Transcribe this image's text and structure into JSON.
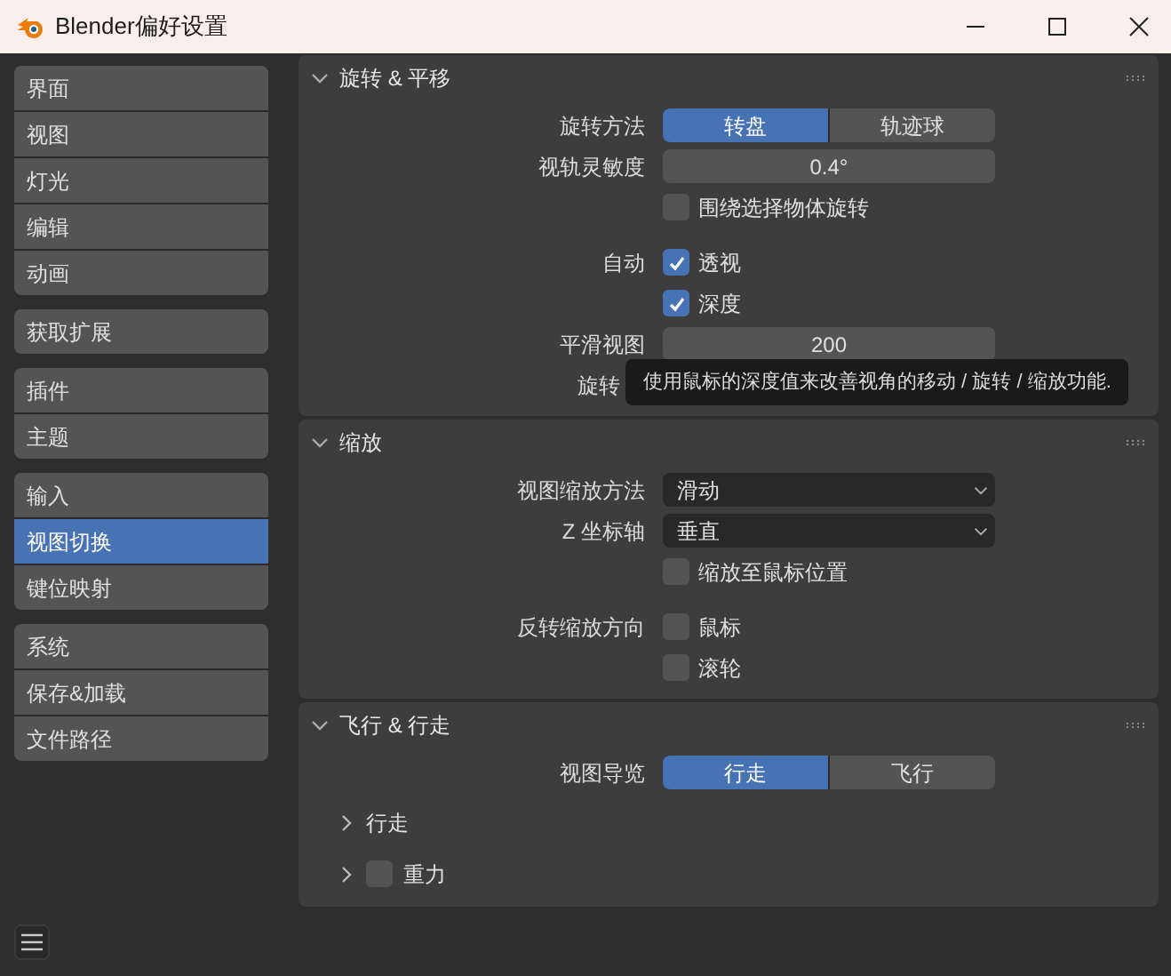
{
  "window": {
    "title": "Blender偏好设置"
  },
  "sidebar": {
    "groups": [
      [
        {
          "label": "界面",
          "selected": false
        },
        {
          "label": "视图",
          "selected": false
        },
        {
          "label": "灯光",
          "selected": false
        },
        {
          "label": "编辑",
          "selected": false
        },
        {
          "label": "动画",
          "selected": false
        }
      ],
      [
        {
          "label": "获取扩展",
          "selected": false
        }
      ],
      [
        {
          "label": "插件",
          "selected": false
        },
        {
          "label": "主题",
          "selected": false
        }
      ],
      [
        {
          "label": "输入",
          "selected": false
        },
        {
          "label": "视图切换",
          "selected": true
        },
        {
          "label": "键位映射",
          "selected": false
        }
      ],
      [
        {
          "label": "系统",
          "selected": false
        },
        {
          "label": "保存&加载",
          "selected": false
        },
        {
          "label": "文件路径",
          "selected": false
        }
      ]
    ]
  },
  "panels": [
    {
      "title": "旋转 & 平移",
      "expanded": true,
      "rows": [
        {
          "kind": "toggle",
          "label": "旋转方法",
          "options": [
            {
              "text": "转盘",
              "selected": true
            },
            {
              "text": "轨迹球",
              "selected": false
            }
          ]
        },
        {
          "kind": "number",
          "label": "视轨灵敏度",
          "value": "0.4°"
        },
        {
          "kind": "checkbox",
          "text": "围绕选择物体旋转",
          "checked": false
        },
        {
          "kind": "checkbox",
          "label": "自动",
          "text": "透视",
          "checked": true
        },
        {
          "kind": "checkbox",
          "text": "深度",
          "checked": true
        },
        {
          "kind": "number",
          "label": "平滑视图",
          "value": "200"
        },
        {
          "kind": "hidden",
          "label": "旋转"
        }
      ]
    },
    {
      "title": "缩放",
      "expanded": true,
      "rows": [
        {
          "kind": "dropdown",
          "label": "视图缩放方法",
          "value": "滑动"
        },
        {
          "kind": "dropdown",
          "label": "Z 坐标轴",
          "value": "垂直"
        },
        {
          "kind": "checkbox",
          "text": "缩放至鼠标位置",
          "checked": false
        },
        {
          "kind": "checkbox",
          "label": "反转缩放方向",
          "text": "鼠标",
          "checked": false
        },
        {
          "kind": "checkbox",
          "text": "滚轮",
          "checked": false
        }
      ]
    },
    {
      "title": "飞行 & 行走",
      "expanded": true,
      "rows": [
        {
          "kind": "toggle",
          "label": "视图导览",
          "options": [
            {
              "text": "行走",
              "selected": true
            },
            {
              "text": "飞行",
              "selected": false
            }
          ]
        },
        {
          "kind": "subpanel",
          "text": "行走",
          "expanded": false
        },
        {
          "kind": "subpanel",
          "text": "重力",
          "expanded": false,
          "checked": false
        }
      ]
    }
  ],
  "tooltip": {
    "text": "使用鼠标的深度值来改善视角的移动 / 旋转 / 缩放功能."
  }
}
